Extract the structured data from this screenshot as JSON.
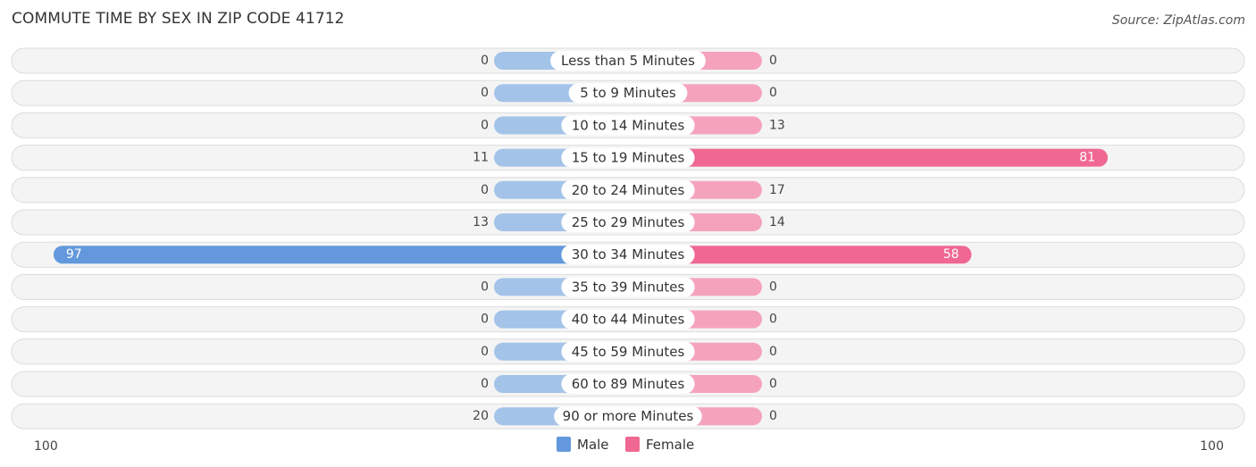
{
  "header": {
    "title": "COMMUTE TIME BY SEX IN ZIP CODE 41712",
    "source": "Source: ZipAtlas.com"
  },
  "colors": {
    "male": "#a4c3e8",
    "male_strong": "#6399dc",
    "female": "#f5a3bd",
    "female_strong": "#f06892"
  },
  "chart_data": {
    "type": "bar",
    "orientation": "horizontal-diverging",
    "title": "COMMUTE TIME BY SEX IN ZIP CODE 41712",
    "categories": [
      "Less than 5 Minutes",
      "5 to 9 Minutes",
      "10 to 14 Minutes",
      "15 to 19 Minutes",
      "20 to 24 Minutes",
      "25 to 29 Minutes",
      "30 to 34 Minutes",
      "35 to 39 Minutes",
      "40 to 44 Minutes",
      "45 to 59 Minutes",
      "60 to 89 Minutes",
      "90 or more Minutes"
    ],
    "series": [
      {
        "name": "Male",
        "values": [
          0,
          0,
          0,
          11,
          0,
          13,
          97,
          0,
          0,
          0,
          0,
          20
        ]
      },
      {
        "name": "Female",
        "values": [
          0,
          0,
          13,
          81,
          17,
          14,
          58,
          0,
          0,
          0,
          0,
          0
        ]
      }
    ],
    "axis": {
      "left_label": "100",
      "right_label": "100",
      "max": 100
    },
    "legend": {
      "items": [
        "Male",
        "Female"
      ],
      "position": "bottom-center"
    },
    "grid": false
  }
}
